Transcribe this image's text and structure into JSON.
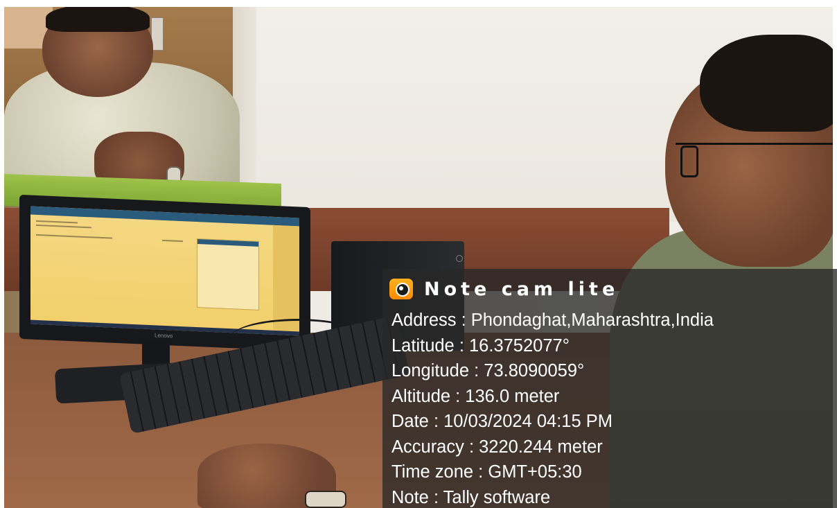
{
  "photo": {
    "monitor_brand": "Lenovo"
  },
  "overlay": {
    "app_name": "Note cam lite",
    "icon": "camera-icon",
    "lines": [
      "Address : Phondaghat,Maharashtra,India",
      "Latitude : 16.3752077°",
      "Longitude : 73.8090059°",
      "Altitude : 136.0 meter",
      "Date : 10/03/2024 04:15 PM",
      "Accuracy : 3220.244 meter",
      "Time zone : GMT+05:30",
      "Note : Tally software"
    ]
  }
}
